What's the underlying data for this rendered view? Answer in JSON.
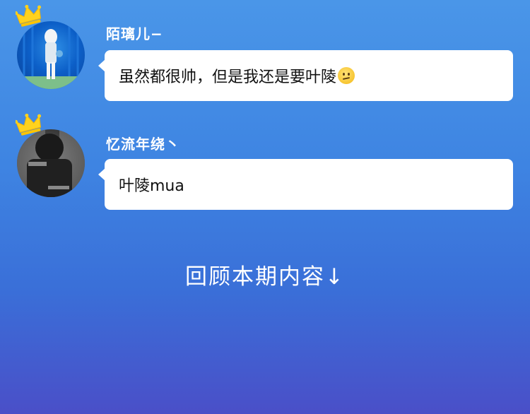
{
  "messages": [
    {
      "username": "陌璃儿−",
      "text": "虽然都很帅，但是我还是要叶陵",
      "emoji": "confused-face-emoji"
    },
    {
      "username": "忆流年绕丶",
      "text": "叶陵mua"
    }
  ],
  "footer": {
    "review_label": "回顾本期内容↓"
  },
  "colors": {
    "background_top": "#4a96e8",
    "background_bottom": "#4a4fc8",
    "bubble": "#ffffff",
    "crown": "#ffd21e"
  }
}
